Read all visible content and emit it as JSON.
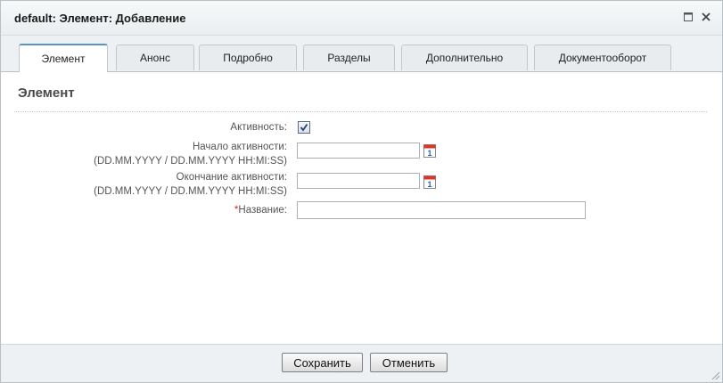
{
  "window": {
    "title": "default: Элемент: Добавление"
  },
  "tabs": [
    {
      "label": "Элемент",
      "active": true
    },
    {
      "label": "Анонс",
      "active": false
    },
    {
      "label": "Подробно",
      "active": false
    },
    {
      "label": "Разделы",
      "active": false
    },
    {
      "label": "Дополнительно",
      "active": false
    },
    {
      "label": "Документооборот",
      "active": false
    }
  ],
  "section": {
    "title": "Элемент"
  },
  "form": {
    "active_label": "Активность:",
    "active_checked": true,
    "start_label": "Начало активности:",
    "start_format": "(DD.MM.YYYY / DD.MM.YYYY HH:MI:SS)",
    "start_value": "",
    "end_label": "Окончание активности:",
    "end_format": "(DD.MM.YYYY / DD.MM.YYYY HH:MI:SS)",
    "end_value": "",
    "name_required_mark": "*",
    "name_label": "Название:",
    "name_value": ""
  },
  "footer": {
    "save_label": "Сохранить",
    "cancel_label": "Отменить"
  },
  "icons": {
    "maximize": "maximize-icon",
    "close": "close-icon",
    "calendar": "calendar-icon",
    "checkmark": "checkmark-icon",
    "resize": "resize-grip-icon"
  },
  "colors": {
    "tab_active_accent": "#5d93c4",
    "required_mark": "#dd2222",
    "calendar_red": "#d9362b",
    "calendar_blue": "#2d5fa8"
  }
}
